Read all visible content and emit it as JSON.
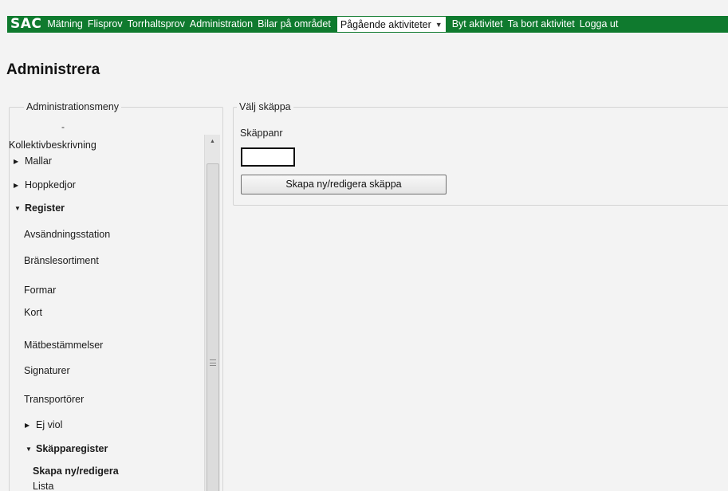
{
  "nav": {
    "logo": "SAC",
    "links": [
      "Mätning",
      "Flisprov",
      "Torrhaltsprov",
      "Administration",
      "Bilar på området"
    ],
    "dropdown_label": "Pågående aktiviteter",
    "right_links": [
      "Byt aktivitet",
      "Ta bort aktivitet",
      "Logga ut"
    ],
    "bar_color": "#0f7a2e"
  },
  "page": {
    "title": "Administrera"
  },
  "admin_menu": {
    "legend": "Administrationsmeny",
    "cut_off": "-",
    "items": [
      {
        "label": "Kollektivbeskrivning",
        "marker": "",
        "bold": false
      },
      {
        "label": "Mallar",
        "marker": "collapsed",
        "bold": false
      },
      {
        "label": "Hoppkedjor",
        "marker": "collapsed",
        "bold": false
      },
      {
        "label": "Register",
        "marker": "expanded",
        "bold": true
      },
      {
        "label": "Avsändningsstation",
        "marker": "",
        "bold": false
      },
      {
        "label": "Bränslesortiment",
        "marker": "",
        "bold": false
      },
      {
        "label": "Formar",
        "marker": "",
        "bold": false
      },
      {
        "label": "Kort",
        "marker": "",
        "bold": false
      },
      {
        "label": "Mätbestämmelser",
        "marker": "",
        "bold": false
      },
      {
        "label": "Signaturer",
        "marker": "",
        "bold": false
      },
      {
        "label": "Transportörer",
        "marker": "",
        "bold": false
      },
      {
        "label": "Ej viol",
        "marker": "collapsed",
        "bold": false
      },
      {
        "label": "Skäpparegister",
        "marker": "expanded",
        "bold": true
      },
      {
        "label": "Skapa ny/redigera",
        "marker": "",
        "bold": true
      },
      {
        "label": "Lista",
        "marker": "",
        "bold": false
      }
    ]
  },
  "valj_skappa": {
    "legend": "Välj skäppa",
    "field_label": "Skäppanr",
    "field_value": "",
    "button_label": "Skapa ny/redigera skäppa"
  }
}
